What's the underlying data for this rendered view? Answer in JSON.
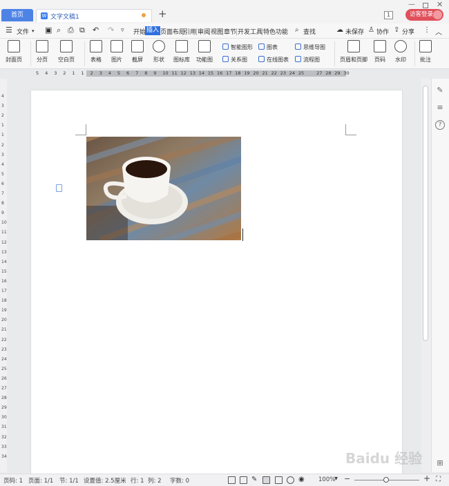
{
  "tabs": {
    "home": "首页",
    "doc": "文字文稿1",
    "new": "+"
  },
  "window": {
    "num": "1",
    "login": "访客登录"
  },
  "menubar": {
    "file": "文件",
    "items": [
      "开始",
      "插入",
      "页面布局",
      "引用",
      "审阅",
      "视图",
      "章节",
      "开发工具",
      "特色功能"
    ],
    "search": "查找",
    "unsaved": "未保存",
    "collab": "协作",
    "share": "分享"
  },
  "ribbon": {
    "big": [
      "封面页",
      "分页",
      "空白页",
      "表格",
      "图片",
      "截屏",
      "形状",
      "图标库",
      "功能图",
      "页眉和页脚",
      "页码",
      "水印",
      "批注"
    ],
    "small": [
      "智能图形",
      "图表",
      "思维导图",
      "关系图",
      "在线图表",
      "流程图"
    ]
  },
  "ruler": {
    "ticks": [
      "5",
      "4",
      "3",
      "2",
      "1",
      "1",
      "2",
      "3",
      "4",
      "5",
      "6",
      "7",
      "8",
      "9",
      "10",
      "11",
      "12",
      "13",
      "14",
      "15",
      "16",
      "17",
      "18",
      "19",
      "20",
      "21",
      "22",
      "23",
      "24",
      "25",
      "27",
      "28",
      "29",
      "30"
    ]
  },
  "vruler": {
    "ticks": [
      "4",
      "3",
      "2",
      "1",
      "1",
      "2",
      "3",
      "4",
      "5",
      "6",
      "7",
      "8",
      "9",
      "10",
      "11",
      "12",
      "13",
      "14",
      "15",
      "16",
      "17",
      "18",
      "19",
      "20",
      "21",
      "22",
      "23",
      "24",
      "25",
      "26",
      "27",
      "28",
      "29",
      "30",
      "31",
      "32",
      "33",
      "34"
    ]
  },
  "status": {
    "page_num": "页码: 1",
    "pages": "页面: 1/1",
    "section": "节: 1/1",
    "setting": "设置值: 2.5厘米",
    "row": "行: 1",
    "col": "列: 2",
    "words": "字数: 0",
    "zoom": "100%",
    "minus": "−",
    "plus": "+"
  },
  "watermark": "Baidu 经验"
}
